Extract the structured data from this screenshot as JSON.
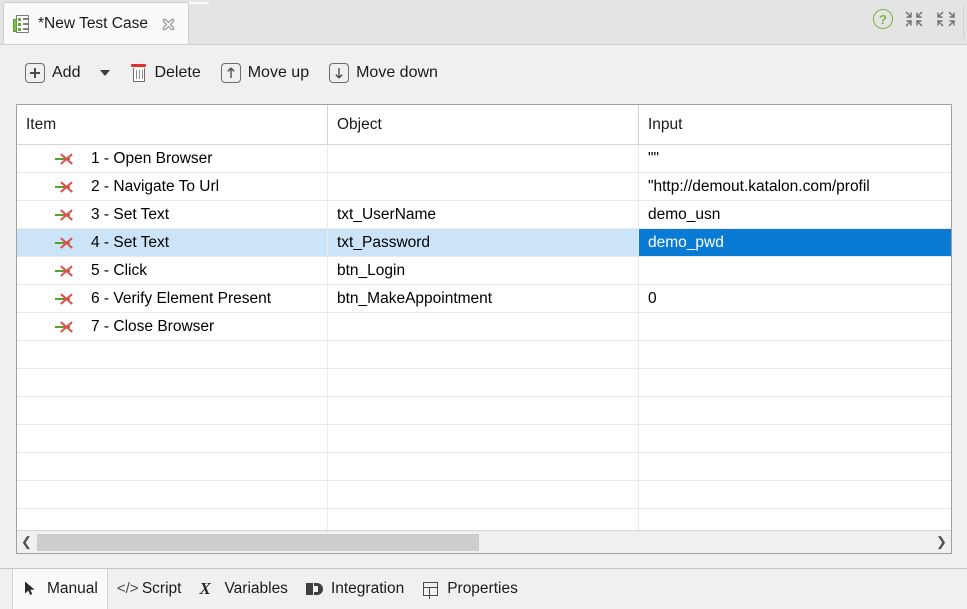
{
  "tab": {
    "title": "*New Test Case",
    "icon": "test-case-icon",
    "close_icon": "close-icon"
  },
  "window_actions": {
    "help_label": "?",
    "minimize_icon": "minimize-icon",
    "maximize_icon": "maximize-icon"
  },
  "toolbar": {
    "add_label": "Add",
    "add_dropdown_icon": "chevron-down-icon",
    "delete_label": "Delete",
    "move_up_label": "Move up",
    "move_down_label": "Move down"
  },
  "table": {
    "columns": [
      {
        "key": "item",
        "label": "Item"
      },
      {
        "key": "object",
        "label": "Object"
      },
      {
        "key": "input",
        "label": "Input"
      }
    ],
    "rows": [
      {
        "item": "1 - Open Browser",
        "object": "",
        "input": "\"\""
      },
      {
        "item": "2 - Navigate To Url",
        "object": "",
        "input": "\"http://demout.katalon.com/profil"
      },
      {
        "item": "3 - Set Text",
        "object": "txt_UserName",
        "input": "demo_usn"
      },
      {
        "item": "4 - Set Text",
        "object": "txt_Password",
        "input": "demo_pwd"
      },
      {
        "item": "5 - Click",
        "object": "btn_Login",
        "input": ""
      },
      {
        "item": "6 - Verify Element Present",
        "object": "btn_MakeAppointment",
        "input": "0"
      },
      {
        "item": "7 - Close Browser",
        "object": "",
        "input": ""
      }
    ],
    "selected_row_index": 3,
    "focused_cell_column": "input",
    "empty_row_count": 7,
    "row_icon": "step-enabled-icon"
  },
  "scrollbar": {
    "left_arrow": "❮",
    "right_arrow": "❯"
  },
  "bottom_tabs": [
    {
      "label": "Manual",
      "icon": "cursor-icon",
      "active": true
    },
    {
      "label": "Script",
      "icon": "code-icon",
      "active": false
    },
    {
      "label": "Variables",
      "icon": "variables-icon",
      "active": false
    },
    {
      "label": "Integration",
      "icon": "integration-icon",
      "active": false
    },
    {
      "label": "Properties",
      "icon": "properties-icon",
      "active": false
    }
  ],
  "colors": {
    "selection_row": "#cce4f7",
    "selection_cell": "#0a7bd4",
    "help_green": "#7cb342",
    "delete_red": "#e03131",
    "step_green": "#5aa02c",
    "step_red": "#e24b4b"
  }
}
